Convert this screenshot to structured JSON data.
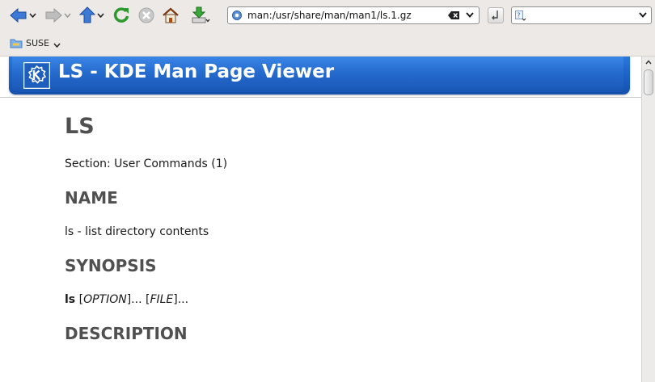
{
  "window": {
    "title": "LS - KDE Man Page Viewer"
  },
  "toolbar": {
    "back_icon": "back-arrow-icon",
    "forward_icon": "forward-arrow-icon",
    "up_icon": "up-arrow-icon",
    "reload_icon": "reload-icon",
    "stop_icon": "stop-icon",
    "home_icon": "home-icon",
    "save_icon": "download-icon"
  },
  "location": {
    "url": "man:/usr/share/man/man1/ls.1.gz"
  },
  "search": {
    "value": ""
  },
  "bookmarks": {
    "items": [
      {
        "label": "SUSE"
      }
    ]
  },
  "page": {
    "banner_title": "LS - KDE Man Page Viewer",
    "heading": "LS",
    "section_line": "Section: User Commands (1)",
    "name_heading": "NAME",
    "name_text": "ls - list directory contents",
    "synopsis_heading": "SYNOPSIS",
    "synopsis": {
      "cmd": "ls",
      "open1": " [",
      "arg1": "OPTION",
      "close1": "]... [",
      "arg2": "FILE",
      "close2": "]..."
    },
    "description_heading": "DESCRIPTION"
  },
  "colors": {
    "banner_blue": "#1d64c7",
    "heading_gray": "#505050",
    "toolbar_bg": "#ece9e6"
  }
}
